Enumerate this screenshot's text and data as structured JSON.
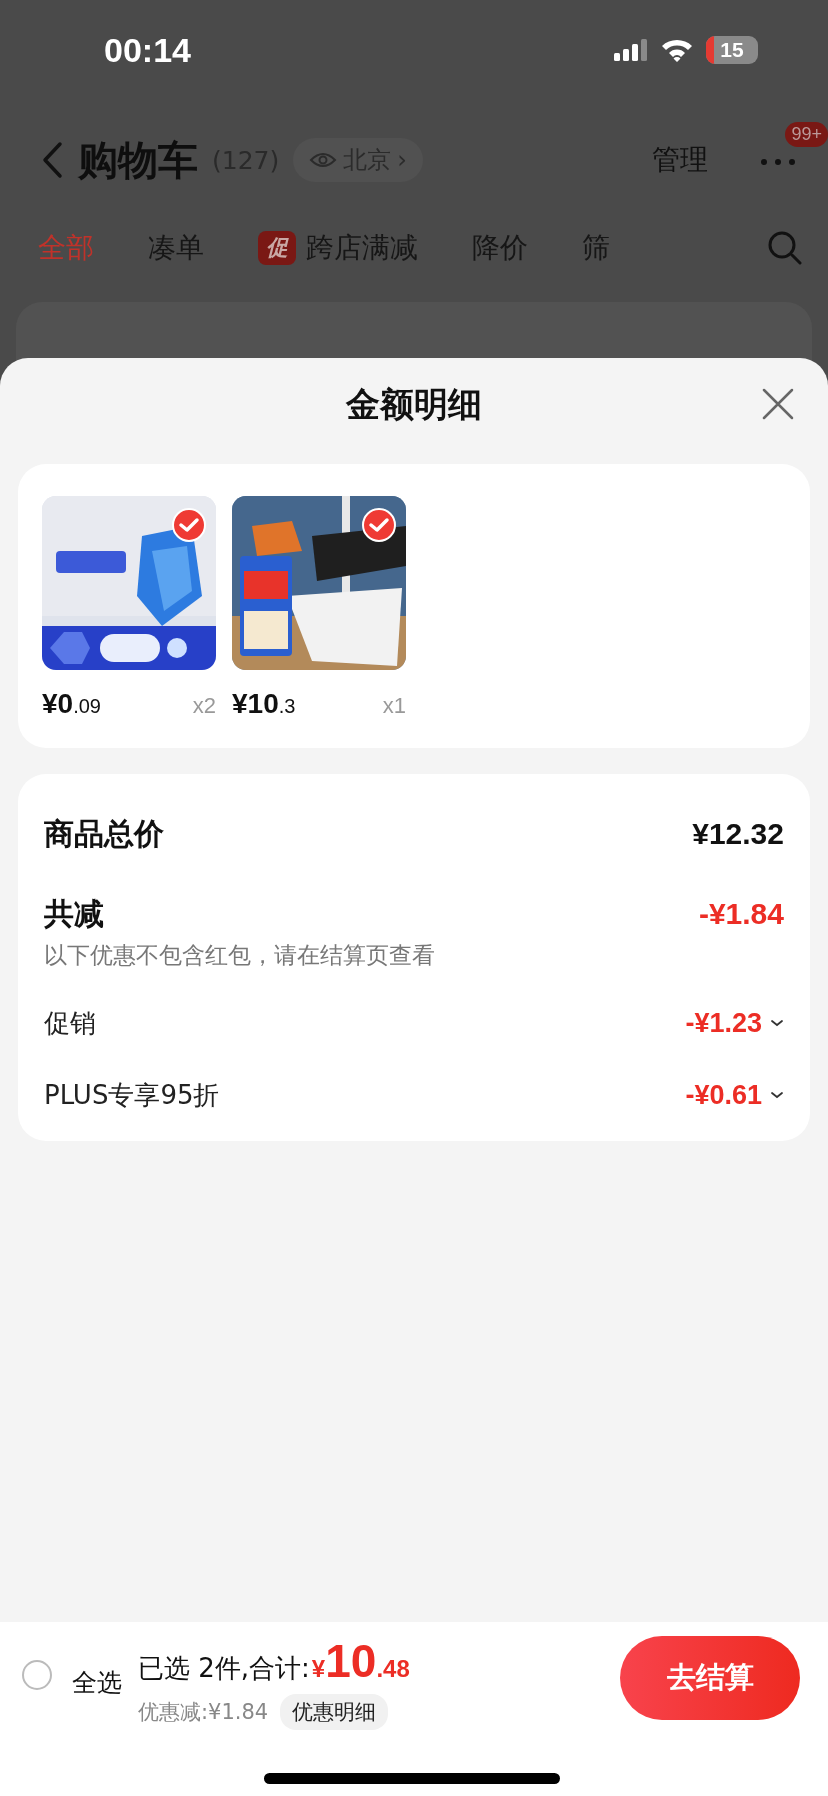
{
  "status_bar": {
    "time": "00:14",
    "battery": "15"
  },
  "header": {
    "title": "购物车",
    "count": "(127)",
    "location": "北京",
    "location_arrow": "›",
    "manage": "管理",
    "badge": "99+"
  },
  "tabs": [
    {
      "label": "全部",
      "selected": true
    },
    {
      "label": "凑单",
      "selected": false
    },
    {
      "label": "跨店满减",
      "selected": false,
      "tag": "促"
    },
    {
      "label": "降价",
      "selected": false
    },
    {
      "label": "筛",
      "selected": false
    }
  ],
  "sheet": {
    "title": "金额明细",
    "products": [
      {
        "kind": "picture",
        "price_integer": "¥0",
        "price_decimal": ".09",
        "quantity": "x2",
        "selected": true
      },
      {
        "kind": "picture",
        "price_integer": "¥10",
        "price_decimal": ".3",
        "quantity": "x1",
        "selected": true
      }
    ],
    "summary": [
      {
        "kind": "total",
        "label": "商品总价",
        "value": "¥12.32"
      },
      {
        "kind": "discount",
        "label": "共减",
        "value": "-¥1.84",
        "note": "以下优惠不包含红包，请在结算页查看"
      },
      {
        "kind": "detail",
        "label": "促销",
        "value": "-¥1.23"
      },
      {
        "kind": "detail",
        "label": "PLUS专享95折",
        "value": "-¥0.61"
      }
    ]
  },
  "bottom_bar": {
    "select_all": {
      "label": "全选",
      "checked": false
    },
    "selected_text": "已选 2件,合计:",
    "total_currency": "¥",
    "total_integer": "10",
    "total_decimal": ".48",
    "discount_text": "优惠减:¥1.84",
    "discount_details": "优惠明细",
    "checkout": "去结算"
  }
}
